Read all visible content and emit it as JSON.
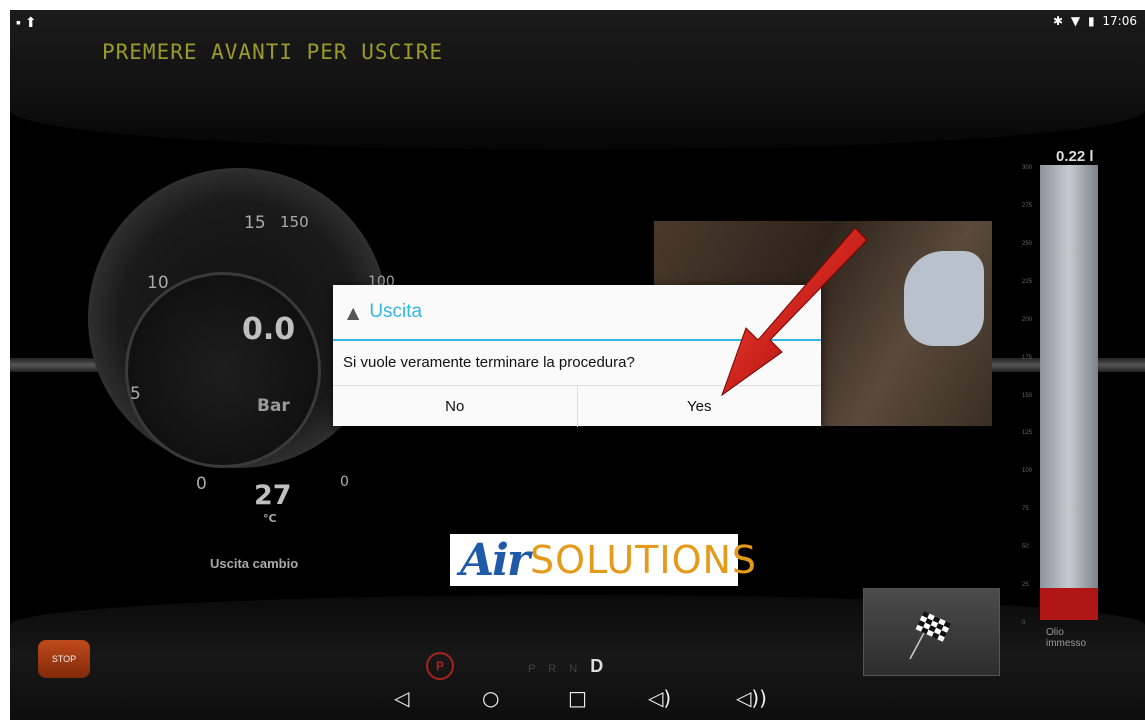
{
  "status_bar": {
    "left_icons": [
      "image-icon",
      "upload-icon"
    ],
    "right_icons": [
      "bluetooth-icon",
      "wifi-icon",
      "battery-icon"
    ],
    "time": "17:06"
  },
  "dashboard": {
    "hint": "PREMERE AVANTI PER USCIRE",
    "gauge": {
      "pressure_value": "0.0",
      "pressure_unit": "Bar",
      "temperature_value": "27",
      "temperature_unit": "°C",
      "label": "Uscita cambio",
      "scale_labels": [
        "15",
        "150",
        "10",
        "100",
        "5",
        "0",
        "0"
      ]
    },
    "oil_level": {
      "value": "0.22 l",
      "fill_fraction": 0.07,
      "label_line1": "Olio",
      "label_line2": "immesso",
      "scale": [
        "300",
        "275",
        "250",
        "225",
        "200",
        "175",
        "150",
        "125",
        "100",
        "75",
        "50",
        "25",
        "0"
      ]
    },
    "gear": {
      "letters": "P R N",
      "active": "D"
    },
    "parking_label": "P",
    "stop_logo_text": "STOP",
    "logo": {
      "air": "Air",
      "solutions": "SOLUTIONS"
    }
  },
  "dialog": {
    "title": "Uscita",
    "message": "Si vuole veramente terminare la procedura?",
    "no_label": "No",
    "yes_label": "Yes"
  },
  "nav_bar": {
    "icons": [
      "back-icon",
      "home-icon",
      "recents-icon",
      "volume-down-icon",
      "volume-up-icon"
    ]
  },
  "colors": {
    "dialog_accent": "#33b5e5",
    "hint_text": "#9a9a2c",
    "oil_fill": "#b11616",
    "logo_blue": "#1f5aa8",
    "logo_orange": "#e49a1a"
  }
}
